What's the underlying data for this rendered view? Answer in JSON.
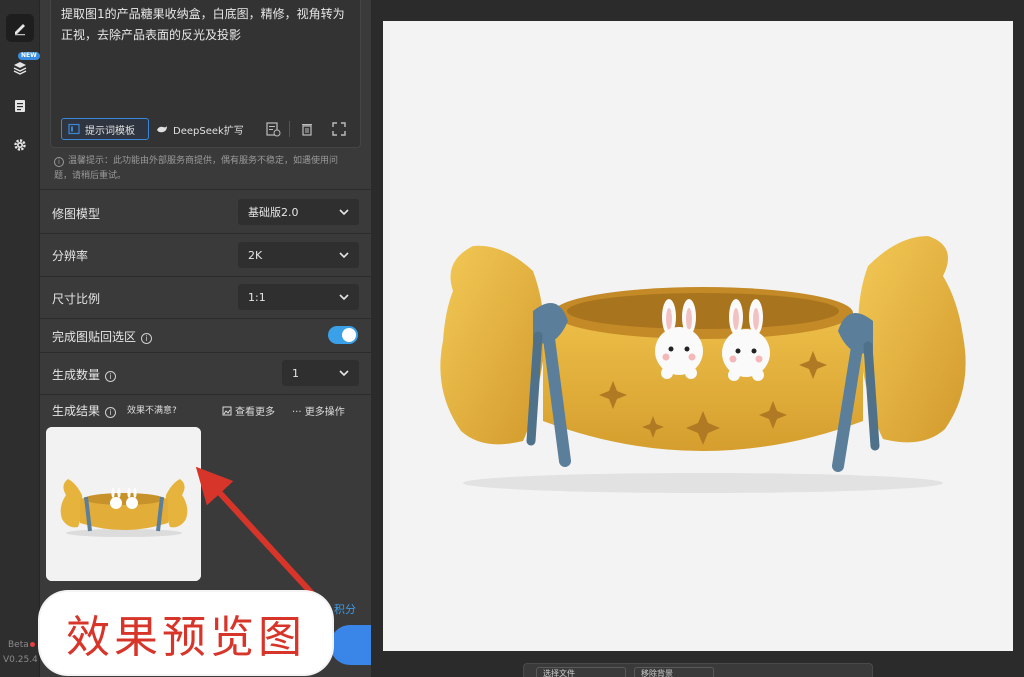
{
  "rail": {
    "icons": [
      "edit-icon",
      "layers-icon",
      "notes-icon",
      "settings-icon"
    ],
    "new_badge": "NEW",
    "beta_label": "Beta",
    "version": "V0.25.4"
  },
  "prompt": {
    "text": "提取图1的产品糖果收纳盒，白底图，精修，视角转为正视，去除产品表面的反光及投影",
    "template_button": "提示词模板",
    "deepseek_button": "DeepSeek扩写"
  },
  "hint": "温馨提示：此功能由外部服务商提供，偶有服务不稳定，如遇使用问题，请稍后重试。",
  "settings": {
    "model": {
      "label": "修图模型",
      "value": "基础版2.0"
    },
    "resolution": {
      "label": "分辨率",
      "value": "2K"
    },
    "ratio": {
      "label": "尺寸比例",
      "value": "1:1"
    },
    "paste_back": {
      "label": "完成图贴回选区",
      "enabled": true
    },
    "count": {
      "label": "生成数量",
      "value": "1"
    }
  },
  "results": {
    "label": "生成结果",
    "feedback": "效果不满意?",
    "view_more": "查看更多",
    "more_actions": "更多操作"
  },
  "points_text": "积分",
  "overlay_label": "效果预览图",
  "bottom_bar": {
    "select_file": "选择文件",
    "remove_bg": "移除背景"
  },
  "colors": {
    "accent": "#3a86e8",
    "annotation_red": "#d8352a",
    "candy_yellow": "#e6b43c",
    "ribbon_blue": "#5b7f9a"
  }
}
